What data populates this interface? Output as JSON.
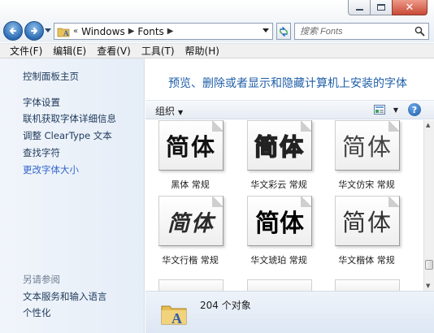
{
  "window": {
    "minimize_icon": "minimize-icon",
    "maximize_icon": "maximize-icon",
    "close_icon": "close-icon"
  },
  "address": {
    "overflow": "«",
    "crumbs": [
      "Windows",
      "Fonts"
    ],
    "search_placeholder": "搜索 Fonts"
  },
  "menu": [
    "文件(F)",
    "编辑(E)",
    "查看(V)",
    "工具(T)",
    "帮助(H)"
  ],
  "sidebar": {
    "home": "控制面板主页",
    "links": [
      "字体设置",
      "联机获取字体详细信息",
      "调整 ClearType 文本",
      "查找字符",
      "更改字体大小"
    ],
    "see_also_heading": "另请参阅",
    "see_also": [
      "文本服务和输入语言",
      "个性化"
    ]
  },
  "main": {
    "title": "预览、删除或者显示和隐藏计算机上安装的字体",
    "organize_label": "组织",
    "fonts": [
      {
        "sample": "简体",
        "name": "黑体 常规"
      },
      {
        "sample": "简体",
        "name": "华文彩云 常规"
      },
      {
        "sample": "简体",
        "name": "华文仿宋 常规"
      },
      {
        "sample": "简体",
        "name": "华文行楷 常规"
      },
      {
        "sample": "简体",
        "name": "华文琥珀 常规"
      },
      {
        "sample": "简体",
        "name": "华文楷体 常规"
      }
    ],
    "status": "204 个对象"
  },
  "colors": {
    "title_blue": "#1f5fa8",
    "link_blue": "#1e395b",
    "highlight_link": "#3366cc",
    "close_red": "#c84a35"
  }
}
